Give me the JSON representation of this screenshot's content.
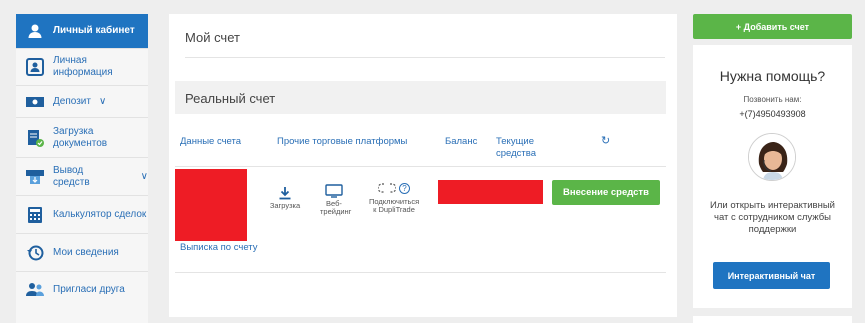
{
  "sidebar": {
    "items": [
      {
        "label": "Личный кабинет",
        "icon": "user-icon",
        "active": true
      },
      {
        "label": "Личная информация",
        "icon": "id-card-icon"
      },
      {
        "label": "Депозит",
        "icon": "cash-icon",
        "has_dropdown": true
      },
      {
        "label": "Загрузка документов",
        "icon": "document-upload-icon"
      },
      {
        "label": "Вывод средств",
        "icon": "withdraw-icon",
        "has_dropdown": true
      },
      {
        "label": "Калькулятор сделок",
        "icon": "calculator-icon"
      },
      {
        "label": "Мои сведения",
        "icon": "history-icon"
      },
      {
        "label": "Пригласи друга",
        "icon": "users-icon"
      }
    ]
  },
  "main": {
    "title": "Мой счет",
    "section_title": "Реальный счет",
    "columns": {
      "account_data": "Данные счета",
      "other_platforms": "Прочие торговые платформы",
      "balance": "Баланс",
      "current_funds": "Текущие средства"
    },
    "row": {
      "statement_link": "Выписка по счету",
      "tools": {
        "download": "Загрузка",
        "web_trading": "Веб-трейдинг",
        "duplitrade": "Подключиться к DupliTrade"
      },
      "deposit_button": "Внесение средств"
    }
  },
  "right_panel": {
    "add_account_button": "+ Добавить счет",
    "help_title": "Нужна помощь?",
    "call_label": "Позвонить нам:",
    "phone": "+(7)4950493908",
    "chat_text": "Или открыть интерактивный чат с сотрудником службы поддержки",
    "chat_button": "Интерактивный чат"
  },
  "colors": {
    "primary_blue": "#1f74c1",
    "link_blue": "#2a6fb6",
    "green": "#5bb548",
    "redacted": "#ee1c25"
  }
}
